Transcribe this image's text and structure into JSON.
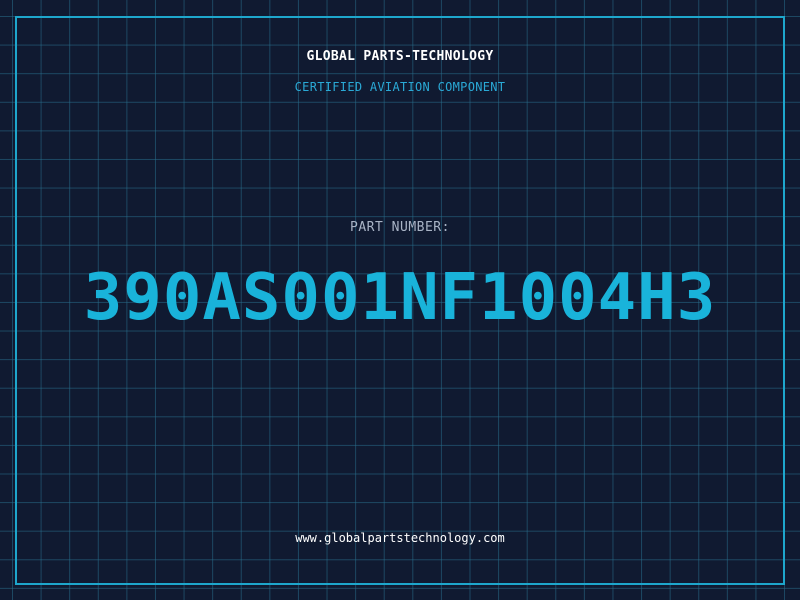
{
  "header": {
    "company": "GLOBAL PARTS-TECHNOLOGY",
    "tagline": "CERTIFIED AVIATION COMPONENT"
  },
  "part": {
    "label": "PART NUMBER:",
    "number": "390AS001NF1004H3"
  },
  "footer": {
    "website": "www.globalpartstechnology.com"
  },
  "colors": {
    "background": "#101a31",
    "grid": "#286e8c",
    "accent": "#19b3da",
    "frame": "#1ea6cc",
    "label": "#a9b4c6",
    "text": "#ffffff"
  }
}
